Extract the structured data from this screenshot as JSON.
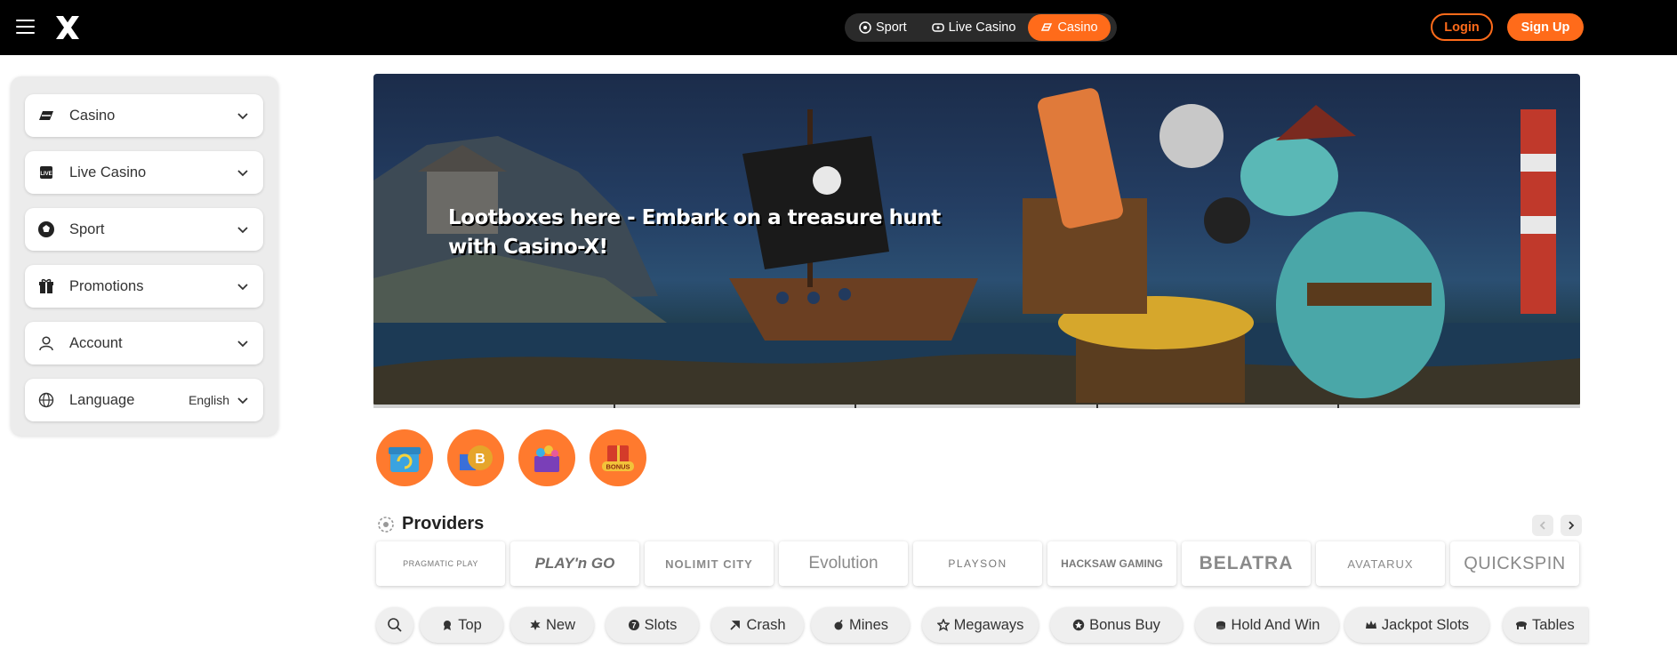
{
  "header": {
    "menu_icon": "hamburger-icon",
    "logo_icon": "x-logo-icon",
    "nav": [
      {
        "label": "Sport",
        "icon": "soccer-ball-icon",
        "active": false
      },
      {
        "label": "Live Casino",
        "icon": "live-casino-icon",
        "active": false
      },
      {
        "label": "Casino",
        "icon": "casino-icon",
        "active": true
      }
    ],
    "login_label": "Login",
    "signup_label": "Sign Up",
    "accent": "#ff6b1a"
  },
  "sidebar": {
    "items": [
      {
        "label": "Casino",
        "icon": "casino-icon"
      },
      {
        "label": "Live Casino",
        "icon": "live-casino-icon"
      },
      {
        "label": "Sport",
        "icon": "soccer-ball-icon"
      },
      {
        "label": "Promotions",
        "icon": "gift-icon"
      },
      {
        "label": "Account",
        "icon": "user-icon"
      },
      {
        "label": "Language",
        "icon": "globe-icon",
        "value": "English"
      }
    ]
  },
  "banner": {
    "text": "Lootboxes here - Embark on a treasure hunt with Casino-X!"
  },
  "promos": [
    {
      "icon": "gift-refresh-icon"
    },
    {
      "icon": "bitcoin-gift-icon"
    },
    {
      "icon": "treasure-chest-icon"
    },
    {
      "icon": "bonus-badge-icon"
    }
  ],
  "providers": {
    "title": "Providers",
    "items": [
      "PRAGMATIC PLAY",
      "PLAY'n GO",
      "NOLIMIT CITY",
      "Evolution",
      "PLAYSON",
      "HACKSAW GAMING",
      "BELATRA",
      "AVATARUX",
      "QUICKSPIN"
    ]
  },
  "categories": [
    {
      "label": "Top",
      "icon": "top-icon"
    },
    {
      "label": "New",
      "icon": "new-icon"
    },
    {
      "label": "Slots",
      "icon": "slots-icon"
    },
    {
      "label": "Crash",
      "icon": "crash-icon"
    },
    {
      "label": "Mines",
      "icon": "mines-icon"
    },
    {
      "label": "Megaways",
      "icon": "megaways-icon"
    },
    {
      "label": "Bonus Buy",
      "icon": "bonus-buy-icon"
    },
    {
      "label": "Hold And Win",
      "icon": "hold-and-win-icon"
    },
    {
      "label": "Jackpot Slots",
      "icon": "crown-icon"
    },
    {
      "label": "Tables",
      "icon": "tables-icon"
    }
  ]
}
